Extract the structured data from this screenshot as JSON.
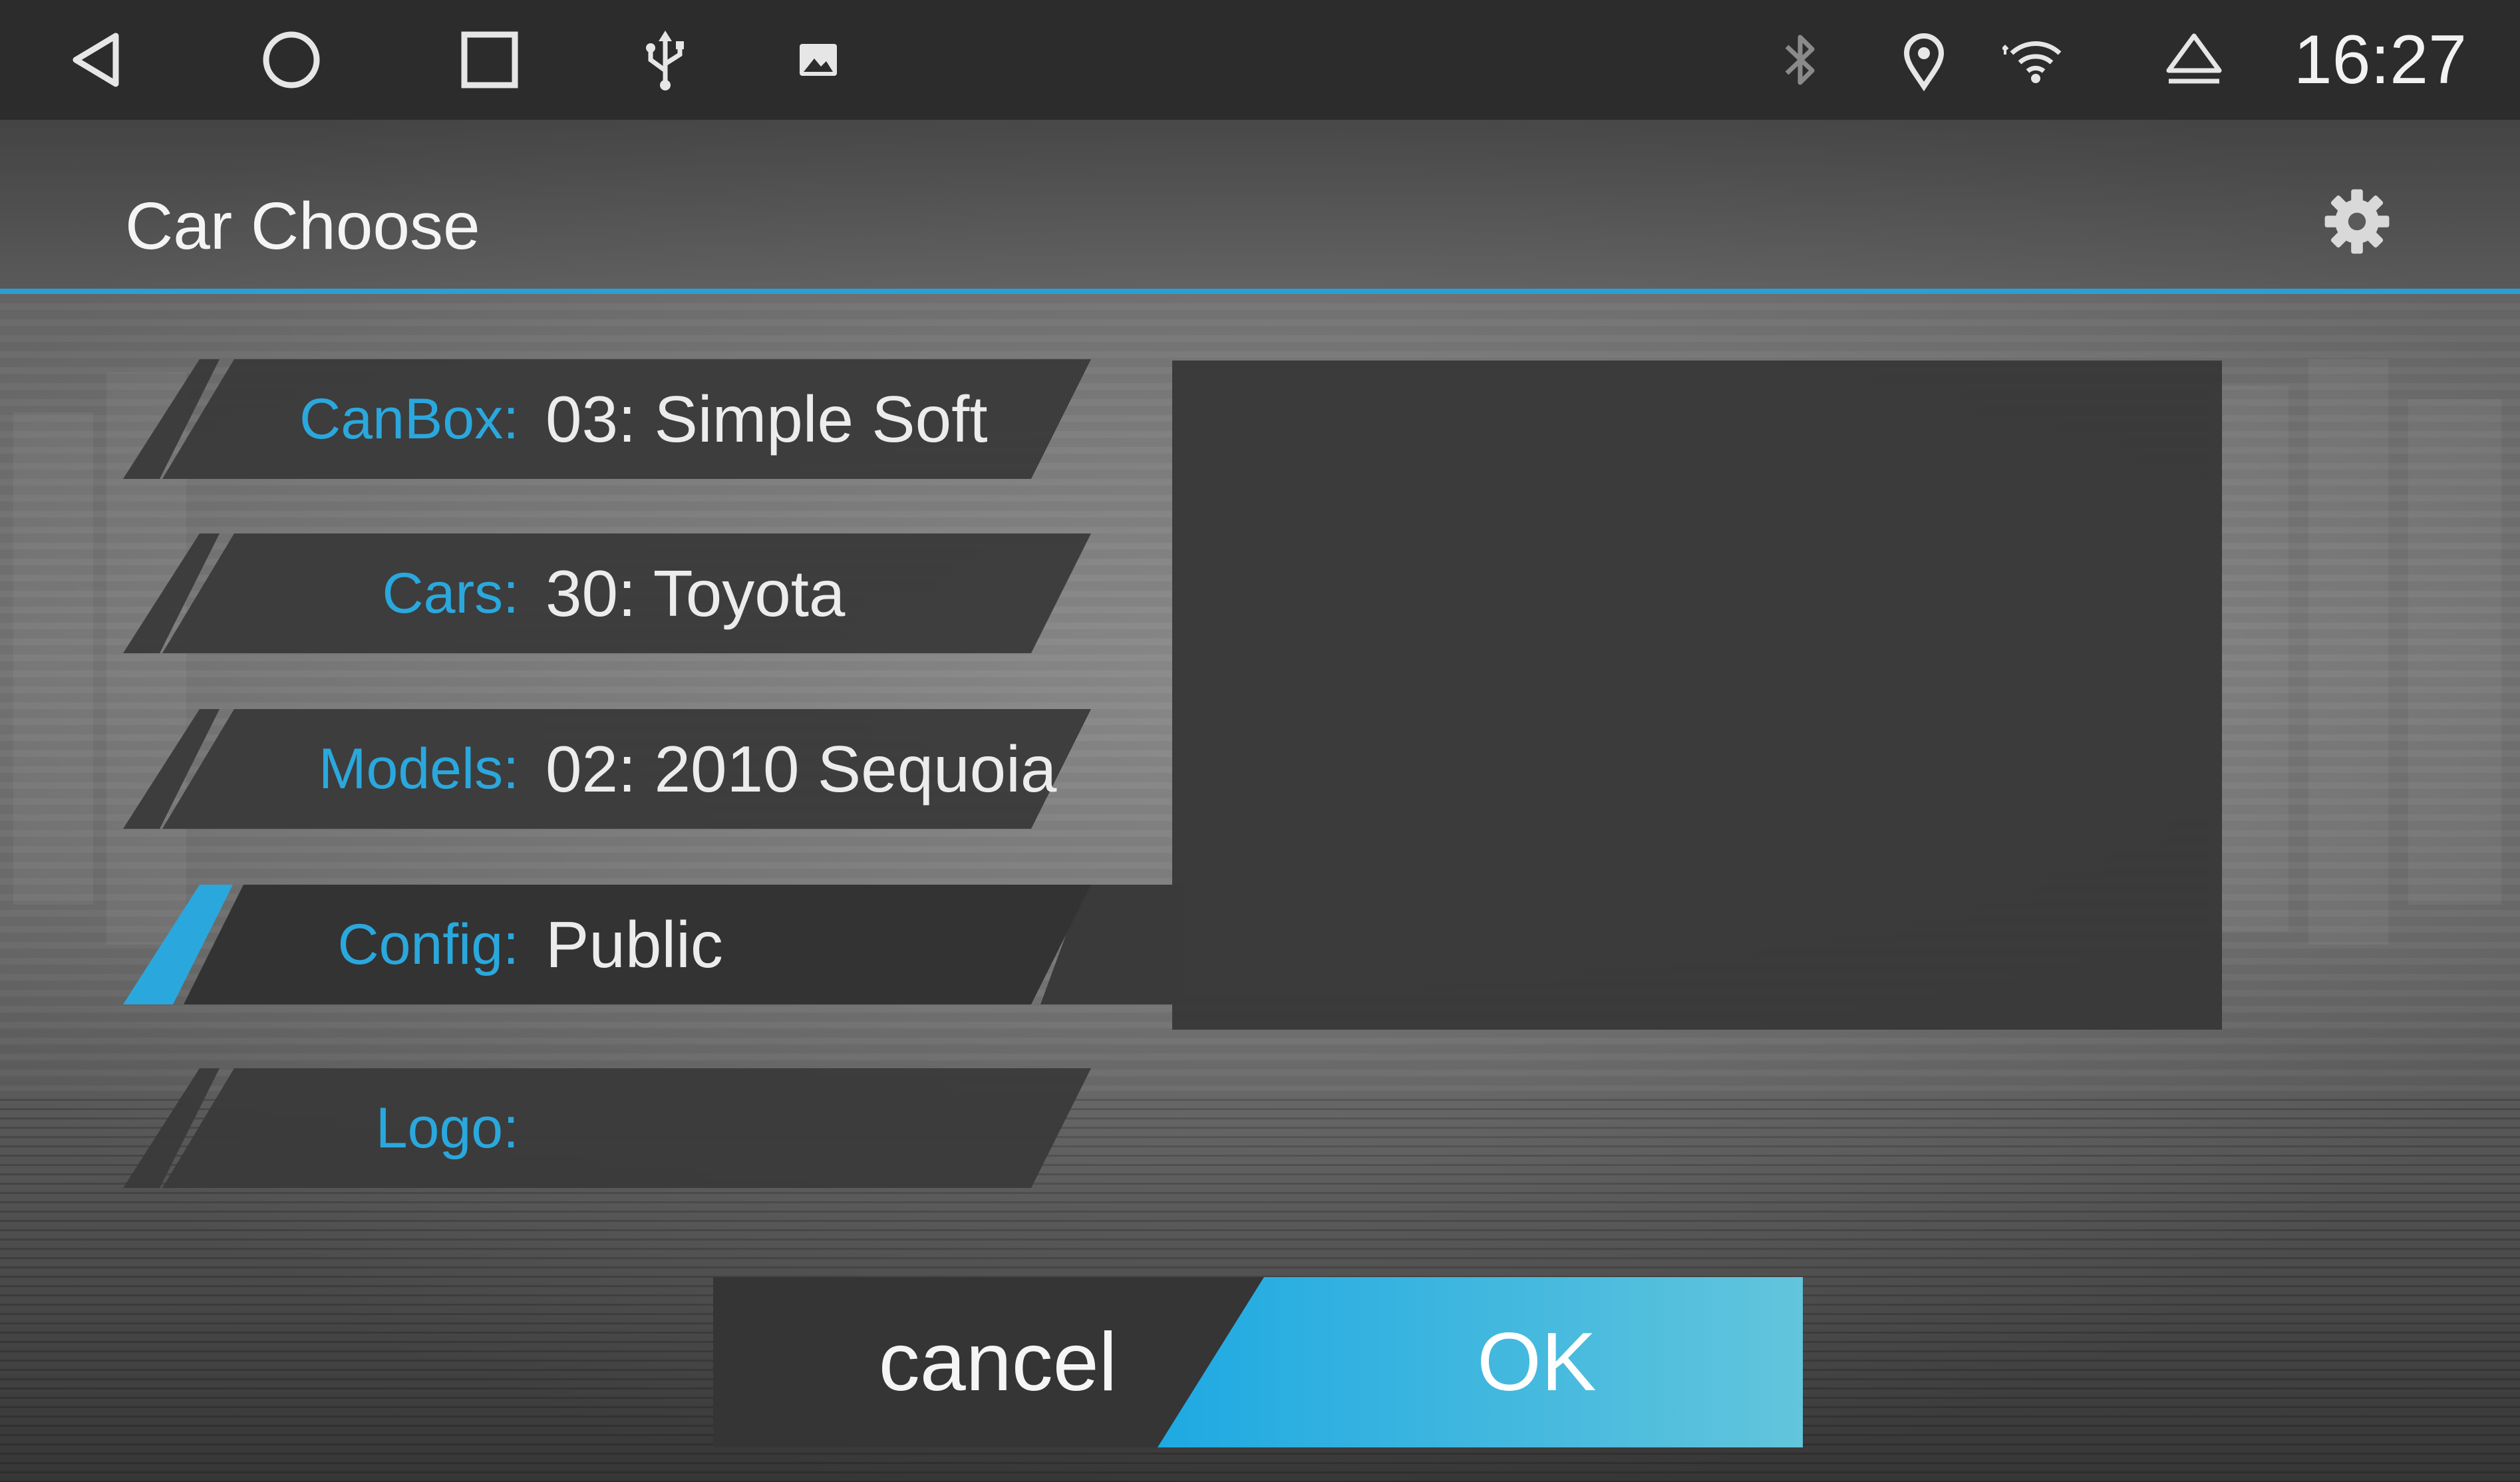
{
  "status_bar": {
    "nav_icons": [
      "back-icon",
      "home-icon",
      "recents-icon"
    ],
    "notification_icons": [
      "usb-icon",
      "image-icon"
    ],
    "status_icons": [
      "bluetooth-icon",
      "location-icon",
      "wifi-icon",
      "eject-icon"
    ],
    "time": "16:27"
  },
  "header": {
    "title": "Car Choose",
    "settings_icon": "gear-icon"
  },
  "settings": {
    "rows": [
      {
        "label": "CanBox:",
        "value": "03: Simple Soft",
        "selected": false
      },
      {
        "label": "Cars:",
        "value": "30: Toyota",
        "selected": false
      },
      {
        "label": "Models:",
        "value": "02: 2010 Sequoia",
        "selected": false
      },
      {
        "label": "Config:",
        "value": "Public",
        "selected": true
      },
      {
        "label": "Logo:",
        "value": "",
        "selected": false
      }
    ]
  },
  "actions": {
    "cancel_label": "cancel",
    "ok_label": "OK"
  },
  "colors": {
    "accent": "#2aa8dd",
    "status_bar": "#2c2c2c",
    "row_background": "#3a3a3a",
    "ok_start": "#1fa9e1",
    "ok_end": "#5fc4dd"
  }
}
